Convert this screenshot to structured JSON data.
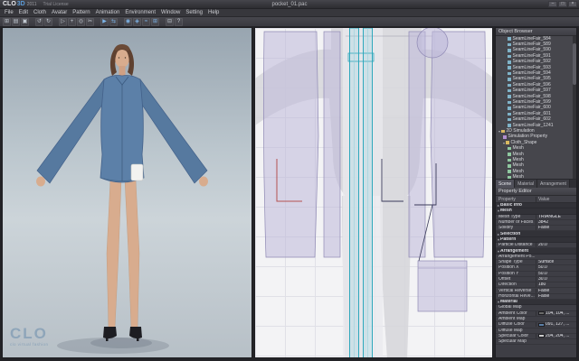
{
  "window": {
    "app": "CLO",
    "app2": "3D",
    "year": "2011",
    "license": "Trial License",
    "title": "pocket_01.pac",
    "controls": [
      "–",
      "□",
      "×"
    ]
  },
  "menu": {
    "items": [
      "File",
      "Edit",
      "Cloth",
      "Avatar",
      "Pattern",
      "Animation",
      "Environment",
      "Window",
      "Setting",
      "Help"
    ]
  },
  "toolbar": {
    "icons": [
      {
        "name": "new",
        "glyph": "⊞"
      },
      {
        "name": "open",
        "glyph": "▤"
      },
      {
        "name": "save",
        "glyph": "▣"
      },
      {
        "name": "undo",
        "glyph": "↺",
        "gap": true
      },
      {
        "name": "redo",
        "glyph": "↻"
      },
      {
        "name": "select",
        "glyph": "▷",
        "gap": true
      },
      {
        "name": "move",
        "glyph": "+"
      },
      {
        "name": "pin",
        "glyph": "◎"
      },
      {
        "name": "scissors",
        "glyph": "✂"
      },
      {
        "name": "simulate",
        "glyph": "▶",
        "blue": true,
        "gap": true
      },
      {
        "name": "sync-2d3d",
        "glyph": "⇆",
        "blue": true
      },
      {
        "name": "show-avatar",
        "glyph": "◉",
        "blue": true,
        "gap": true
      },
      {
        "name": "show-cloth",
        "glyph": "◈",
        "blue": true
      },
      {
        "name": "show-seamline",
        "glyph": "≈",
        "blue": true
      },
      {
        "name": "show-grid",
        "glyph": "⊞",
        "blue": true
      },
      {
        "name": "window-layout",
        "glyph": "⊟",
        "gap": true
      },
      {
        "name": "help",
        "glyph": "?"
      }
    ]
  },
  "viewport": {
    "logo_main": "CLO",
    "logo_sub": "clo virtual fashion"
  },
  "object_browser": {
    "title": "Object Browser",
    "items": [
      {
        "label": "SeamLineFair_584",
        "level": 2,
        "icon": "seamline"
      },
      {
        "label": "SeamLineFair_589",
        "level": 2,
        "icon": "seamline"
      },
      {
        "label": "SeamLineFair_590",
        "level": 2,
        "icon": "seamline"
      },
      {
        "label": "SeamLineFair_591",
        "level": 2,
        "icon": "seamline"
      },
      {
        "label": "SeamLineFair_592",
        "level": 2,
        "icon": "seamline"
      },
      {
        "label": "SeamLineFair_593",
        "level": 2,
        "icon": "seamline"
      },
      {
        "label": "SeamLineFair_594",
        "level": 2,
        "icon": "seamline"
      },
      {
        "label": "SeamLineFair_595",
        "level": 2,
        "icon": "seamline"
      },
      {
        "label": "SeamLineFair_596",
        "level": 2,
        "icon": "seamline"
      },
      {
        "label": "SeamLineFair_597",
        "level": 2,
        "icon": "seamline"
      },
      {
        "label": "SeamLineFair_598",
        "level": 2,
        "icon": "seamline"
      },
      {
        "label": "SeamLineFair_599",
        "level": 2,
        "icon": "seamline"
      },
      {
        "label": "SeamLineFair_600",
        "level": 2,
        "icon": "seamline"
      },
      {
        "label": "SeamLineFair_601",
        "level": 2,
        "icon": "seamline"
      },
      {
        "label": "SeamLineFair_602",
        "level": 2,
        "icon": "seamline"
      },
      {
        "label": "SeamLineFair_1241",
        "level": 2,
        "icon": "seamline"
      },
      {
        "label": "2D Simulation",
        "level": 0,
        "icon": "folder",
        "arrow": "▾"
      },
      {
        "label": "Simulation Property",
        "level": 1,
        "icon": "prop"
      },
      {
        "label": "Cloth_Shape",
        "level": 1,
        "icon": "folder",
        "arrow": "▾"
      },
      {
        "label": "Mesh",
        "level": 2,
        "icon": "mesh"
      },
      {
        "label": "Mesh",
        "level": 2,
        "icon": "mesh"
      },
      {
        "label": "Mesh",
        "level": 2,
        "icon": "mesh"
      },
      {
        "label": "Mesh",
        "level": 2,
        "icon": "mesh"
      },
      {
        "label": "Mesh",
        "level": 2,
        "icon": "mesh"
      },
      {
        "label": "Mesh",
        "level": 2,
        "icon": "mesh"
      }
    ],
    "tabs": [
      {
        "label": "Scene",
        "active": true
      },
      {
        "label": "Material",
        "active": false
      },
      {
        "label": "Arrangement",
        "active": false
      }
    ]
  },
  "property_editor": {
    "title": "Property Editor",
    "columns": {
      "property": "Property",
      "value": "Value"
    },
    "rows": [
      {
        "t": "sec",
        "label": "Basic Info",
        "arrow": "▸"
      },
      {
        "t": "sec",
        "label": "Mesh",
        "arrow": "▾"
      },
      {
        "t": "prop",
        "label": "Mesh Type",
        "value": "TRIANGLE"
      },
      {
        "t": "prop",
        "label": "Number of Faces",
        "value": "3842"
      },
      {
        "t": "prop",
        "label": "Solidify",
        "value": "False"
      },
      {
        "t": "sec",
        "label": "Selection",
        "arrow": "▸"
      },
      {
        "t": "sec",
        "label": "Pattern",
        "arrow": "▾"
      },
      {
        "t": "prop",
        "label": "Particle Distance",
        "value": "20.0"
      },
      {
        "t": "sec",
        "label": "Arrangement",
        "arrow": "▾"
      },
      {
        "t": "prop",
        "label": "Arrangement Po...",
        "value": ""
      },
      {
        "t": "prop",
        "label": "Shape Type",
        "value": "Surface"
      },
      {
        "t": "prop",
        "label": "Position X",
        "value": "50.0"
      },
      {
        "t": "prop",
        "label": "Position Y",
        "value": "50.0"
      },
      {
        "t": "prop",
        "label": "Offset",
        "value": "30.0"
      },
      {
        "t": "prop",
        "label": "Direction",
        "value": "180"
      },
      {
        "t": "prop",
        "label": "Vertical Reverse",
        "value": "False"
      },
      {
        "t": "prop",
        "label": "Horizontal Reve...",
        "value": "False"
      },
      {
        "t": "sec",
        "label": "Material",
        "arrow": "▾"
      },
      {
        "t": "prop",
        "label": "Global Map",
        "value": ""
      },
      {
        "t": "color",
        "label": "Ambient Color",
        "swatch": "#6a6a6a",
        "value": "104, 104, ..."
      },
      {
        "t": "prop",
        "label": "Ambient Map",
        "value": ""
      },
      {
        "t": "color",
        "label": "Diffuse Color",
        "swatch": "#5b7fa6",
        "value": "091, 127, ..."
      },
      {
        "t": "prop",
        "label": "Diffuse Map",
        "value": ""
      },
      {
        "t": "color",
        "label": "Specular Color",
        "swatch": "#cccccc",
        "value": "204, 204, ..."
      },
      {
        "t": "prop",
        "label": "Specular Map",
        "value": ""
      }
    ]
  },
  "colors": {
    "accent_teal": "#2fa8bc",
    "jacket_blue": "#5c80a8",
    "pattern_lavender": "#beb8d8",
    "dart_red": "#b45050"
  }
}
